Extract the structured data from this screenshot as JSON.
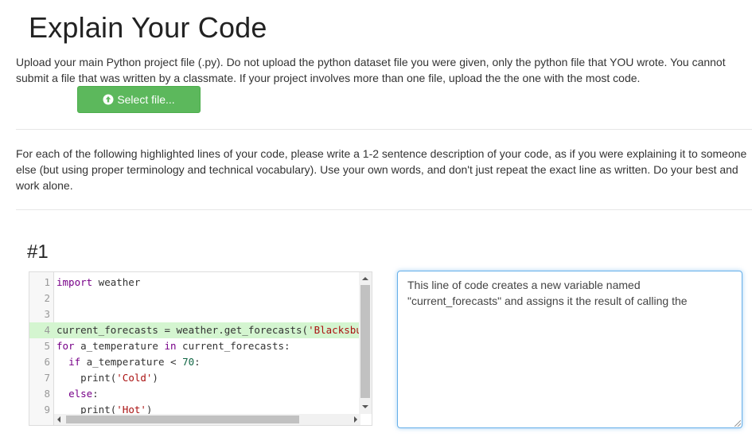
{
  "page": {
    "title": "Explain Your Code",
    "upload_instructions": "Upload your main Python project file (.py). Do not upload the python dataset file you were given, only the python file that YOU wrote. You cannot submit a file that was written by a classmate. If your project involves more than one file, upload the the one with the most code.",
    "select_file_label": "Select file...",
    "explain_instructions": "For each of the following highlighted lines of your code, please write a 1-2 sentence description of your code, as if you were explaining it to someone else (but using proper terminology and technical vocabulary). Use your own words, and don't just repeat the exact line as written. Do your best and work alone."
  },
  "question": {
    "number": "#1",
    "answer_text": "This line of code creates a new variable named \"current_forecasts\" and assigns it the result of calling the"
  },
  "code": {
    "lines": [
      {
        "n": "1",
        "text": "import weather"
      },
      {
        "n": "2",
        "text": ""
      },
      {
        "n": "3",
        "text": ""
      },
      {
        "n": "4",
        "text": "current_forecasts = weather.get_forecasts('Blacksburg, VA')"
      },
      {
        "n": "5",
        "text": "for a_temperature in current_forecasts:"
      },
      {
        "n": "6",
        "text": "  if a_temperature < 70:"
      },
      {
        "n": "7",
        "text": "    print('Cold')"
      },
      {
        "n": "8",
        "text": "  else:"
      },
      {
        "n": "9",
        "text": "    print('Hot')"
      }
    ],
    "highlighted_line": 4
  },
  "colors": {
    "button": "#5cb85c",
    "highlight": "#d4f5d0",
    "focus_border": "#66afe9"
  }
}
